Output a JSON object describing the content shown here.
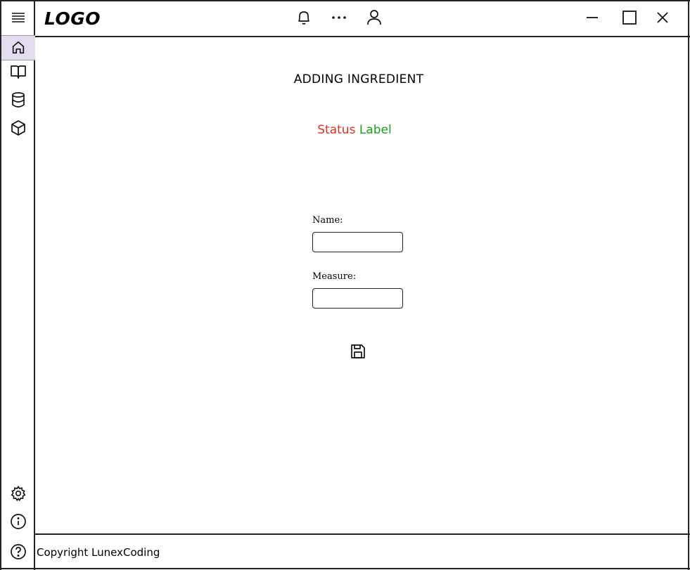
{
  "app": {
    "logo": "LOGO"
  },
  "sidebar": {
    "items": [
      {
        "id": "menu",
        "icon": "hamburger-menu-icon"
      },
      {
        "id": "home",
        "icon": "home-icon",
        "active": true
      },
      {
        "id": "book",
        "icon": "book-icon"
      },
      {
        "id": "database",
        "icon": "database-icon"
      },
      {
        "id": "package",
        "icon": "cube-icon"
      },
      {
        "id": "settings",
        "icon": "gear-icon"
      },
      {
        "id": "info",
        "icon": "info-icon"
      },
      {
        "id": "help",
        "icon": "help-icon"
      }
    ],
    "active_color": "#e6dcef"
  },
  "topbar": {
    "icons": [
      "bell-icon",
      "more-horizontal-icon",
      "user-icon"
    ],
    "window_controls": [
      "minimize-icon",
      "maximize-icon",
      "close-icon"
    ]
  },
  "main": {
    "title": "ADDING INGREDIENT",
    "status": {
      "word1": "Status",
      "word2": "Label",
      "color1": "#e03020",
      "color2": "#1aa01a"
    },
    "form": {
      "name_label": "Name:",
      "name_value": "",
      "measure_label": "Measure:",
      "measure_value": "",
      "save_icon": "save-icon"
    }
  },
  "footer": {
    "copyright": "Copyright LunexCoding"
  }
}
